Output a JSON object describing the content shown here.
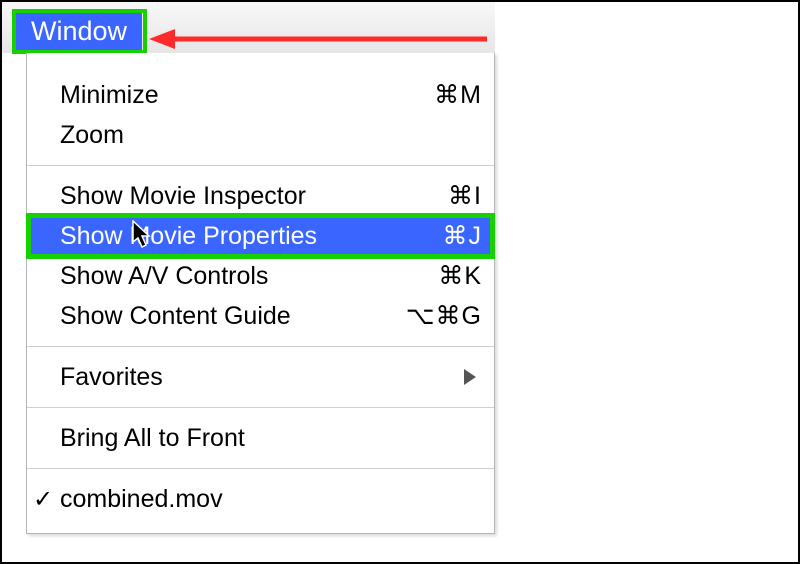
{
  "menubar": {
    "title": "Window"
  },
  "menu": {
    "minimize": {
      "label": "Minimize",
      "shortcut": "⌘M"
    },
    "zoom": {
      "label": "Zoom",
      "shortcut": ""
    },
    "inspector": {
      "label": "Show Movie Inspector",
      "shortcut": "⌘I"
    },
    "properties": {
      "label": "Show Movie Properties",
      "shortcut": "⌘J"
    },
    "av": {
      "label": "Show A/V Controls",
      "shortcut": "⌘K"
    },
    "guide": {
      "label": "Show Content Guide",
      "shortcut": "⌥⌘G"
    },
    "favorites": {
      "label": "Favorites",
      "shortcut": ""
    },
    "bringfront": {
      "label": "Bring All to Front",
      "shortcut": ""
    },
    "doc1": {
      "label": "combined.mov",
      "shortcut": ""
    }
  }
}
